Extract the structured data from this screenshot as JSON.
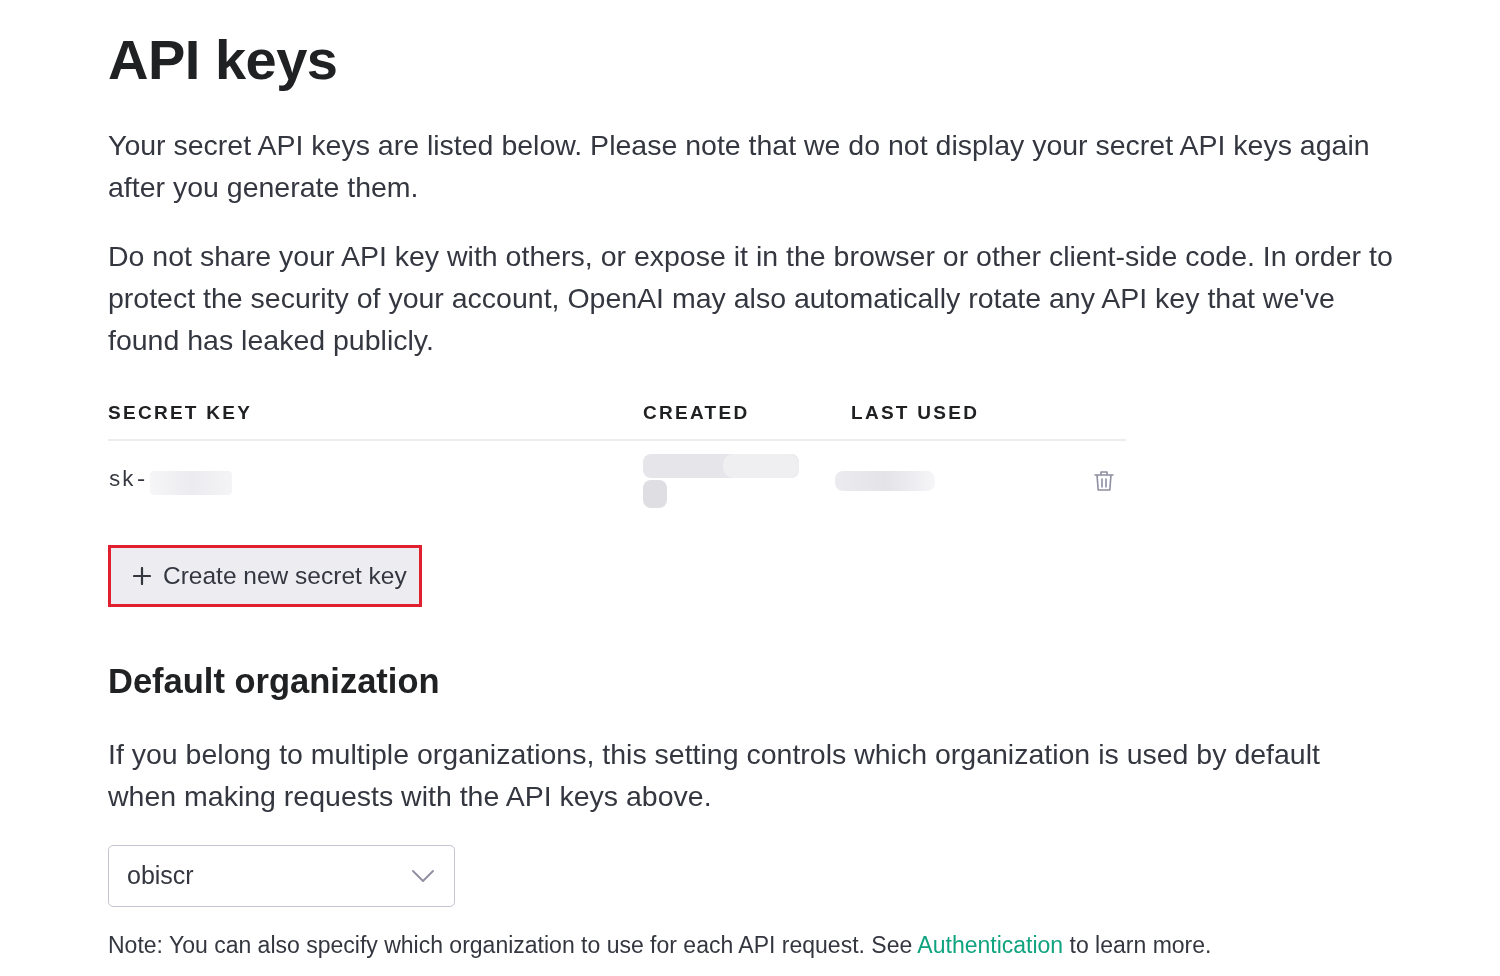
{
  "title": "API keys",
  "intro": [
    "Your secret API keys are listed below. Please note that we do not display your secret API keys again after you generate them.",
    "Do not share your API key with others, or expose it in the browser or other client-side code. In order to protect the security of your account, OpenAI may also automatically rotate any API key that we've found has leaked publicly."
  ],
  "keys_table": {
    "columns": [
      "SECRET KEY",
      "CREATED",
      "LAST USED"
    ],
    "rows": [
      {
        "secret_key": "sk-",
        "secret_key_redacted": true,
        "created_redacted": true,
        "last_used_redacted": true
      }
    ]
  },
  "create_button": {
    "label": "Create new secret key",
    "highlighted": true
  },
  "default_organization": {
    "heading": "Default organization",
    "description": "If you belong to multiple organizations, this setting controls which organization is used by default when making requests with the API keys above.",
    "select": {
      "value": "obiscr"
    },
    "note": {
      "before": "Note: You can also specify which organization to use for each API request. See",
      "link": "Authentication",
      "after": "to learn more."
    }
  }
}
